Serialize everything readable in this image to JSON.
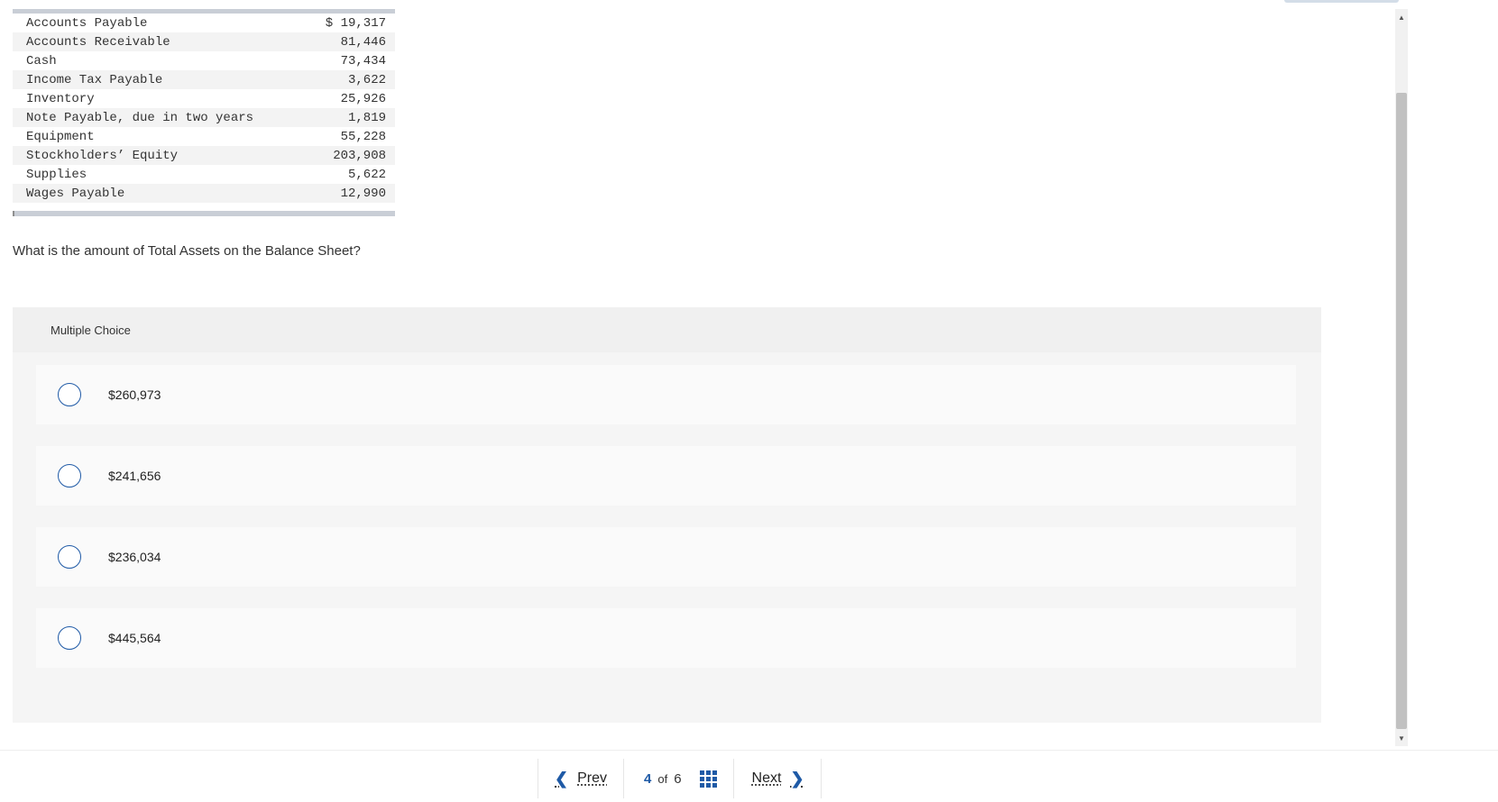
{
  "balance_items": [
    {
      "label": "Accounts Payable",
      "amount": "$ 19,317"
    },
    {
      "label": "Accounts Receivable",
      "amount": "81,446"
    },
    {
      "label": "Cash",
      "amount": "73,434"
    },
    {
      "label": "Income Tax Payable",
      "amount": "3,622"
    },
    {
      "label": "Inventory",
      "amount": "25,926"
    },
    {
      "label": "Note Payable, due in two years",
      "amount": "1,819"
    },
    {
      "label": "Equipment",
      "amount": "55,228"
    },
    {
      "label": "Stockholders’ Equity",
      "amount": "203,908"
    },
    {
      "label": "Supplies",
      "amount": "5,622"
    },
    {
      "label": "Wages Payable",
      "amount": "12,990"
    }
  ],
  "question": "What is the amount of Total Assets on the Balance Sheet?",
  "multiple_choice": {
    "header": "Multiple Choice",
    "options": [
      "$260,973",
      "$241,656",
      "$236,034",
      "$445,564"
    ]
  },
  "nav": {
    "prev_label": "Prev",
    "current": "4",
    "of_label": "of",
    "total": "6",
    "next_label": "Next"
  },
  "icons": {
    "prev": "chevron-left-icon",
    "next": "chevron-right-icon",
    "grid": "grid-icon",
    "scroll_up": "caret-up-icon",
    "scroll_down": "caret-down-icon"
  },
  "colors": {
    "accent": "#1f5aa6",
    "panel_bg": "#f5f5f5",
    "option_bg": "#fafafa"
  }
}
